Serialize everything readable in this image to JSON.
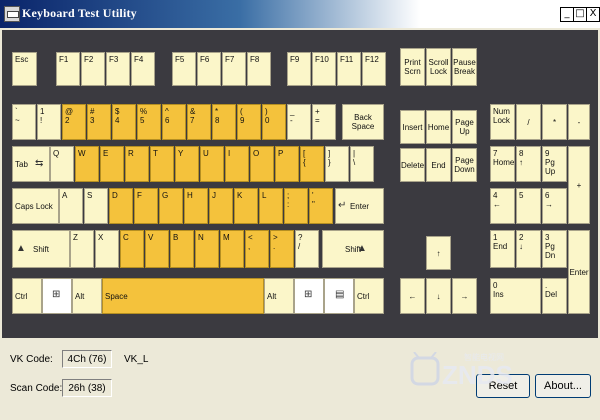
{
  "window": {
    "title": "Keyboard Test Utility",
    "minimize": "_",
    "maximize": "□",
    "close": "X"
  },
  "row_fn": [
    "Esc",
    "F1",
    "F2",
    "F3",
    "F4",
    "F5",
    "F6",
    "F7",
    "F8",
    "F9",
    "F10",
    "F11",
    "F12"
  ],
  "nav_top": [
    "Print Scrn",
    "Scroll Lock",
    "Pause Break"
  ],
  "row_num": [
    {
      "k": "`\n~",
      "on": false
    },
    {
      "k": "1\n!",
      "on": false
    },
    {
      "k": "@\n2",
      "on": true
    },
    {
      "k": "#\n3",
      "on": true
    },
    {
      "k": "$\n4",
      "on": true
    },
    {
      "k": "%\n5",
      "on": true
    },
    {
      "k": "^\n6",
      "on": true
    },
    {
      "k": "&\n7",
      "on": true
    },
    {
      "k": "*\n8",
      "on": true
    },
    {
      "k": "(\n9",
      "on": true
    },
    {
      "k": ")\n0",
      "on": true
    },
    {
      "k": "_\n-",
      "on": false
    },
    {
      "k": "+\n=",
      "on": false
    }
  ],
  "backspace": "Back Space",
  "row_q": [
    "Q",
    "W",
    "E",
    "R",
    "T",
    "Y",
    "U",
    "I",
    "O",
    "P",
    "[\n{",
    "]\n}",
    "|\n\\"
  ],
  "row_q_on": [
    false,
    true,
    true,
    true,
    true,
    true,
    true,
    true,
    true,
    true,
    true,
    false,
    false
  ],
  "tab": "Tab",
  "row_a": [
    "A",
    "S",
    "D",
    "F",
    "G",
    "H",
    "J",
    "K",
    "L",
    ";\n:",
    "'\n\""
  ],
  "row_a_on": [
    false,
    false,
    true,
    true,
    true,
    true,
    true,
    true,
    true,
    true,
    true
  ],
  "capslock": "Caps Lock",
  "enter": "Enter",
  "row_z": [
    "Z",
    "X",
    "C",
    "V",
    "B",
    "N",
    "M",
    "<\n,",
    ">\n.",
    "?\n/"
  ],
  "row_z_on": [
    false,
    false,
    true,
    true,
    true,
    true,
    true,
    true,
    true,
    false
  ],
  "shift": "Shift",
  "ctrl": "Ctrl",
  "alt": "Alt",
  "space": "Space",
  "nav_mid": [
    "Insert",
    "Home",
    "Page Up",
    "Delete",
    "End",
    "Page Down"
  ],
  "arrows": {
    "up": "↑",
    "left": "←",
    "down": "↓",
    "right": "→"
  },
  "numpad": {
    "numlock": "Num Lock",
    "div": "/",
    "mul": "*",
    "minus": "-",
    "n7": "7\nHome",
    "n8": "8\n↑",
    "n9": "9\nPg Up",
    "plus": "+",
    "n4": "4\n←",
    "n5": "5",
    "n6": "6\n→",
    "n1": "1\nEnd",
    "n2": "2\n↓",
    "n3": "3\nPg Dn",
    "enter": "Enter",
    "n0": "0\nIns",
    "dot": ".\nDel"
  },
  "status": {
    "vk_label": "VK Code:",
    "vk_value": "4Ch (76)",
    "vk_name": "VK_L",
    "scan_label": "Scan Code:",
    "scan_value": "26h (38)"
  },
  "buttons": {
    "reset": "Reset",
    "about": "About..."
  },
  "watermark": {
    "brand": "ZNDS",
    "cn": "智能电视网",
    ".com": ".com"
  },
  "colors": {
    "key": "#fbf6c9",
    "key_pressed": "#f4c23c",
    "board": "#3b3a40"
  }
}
